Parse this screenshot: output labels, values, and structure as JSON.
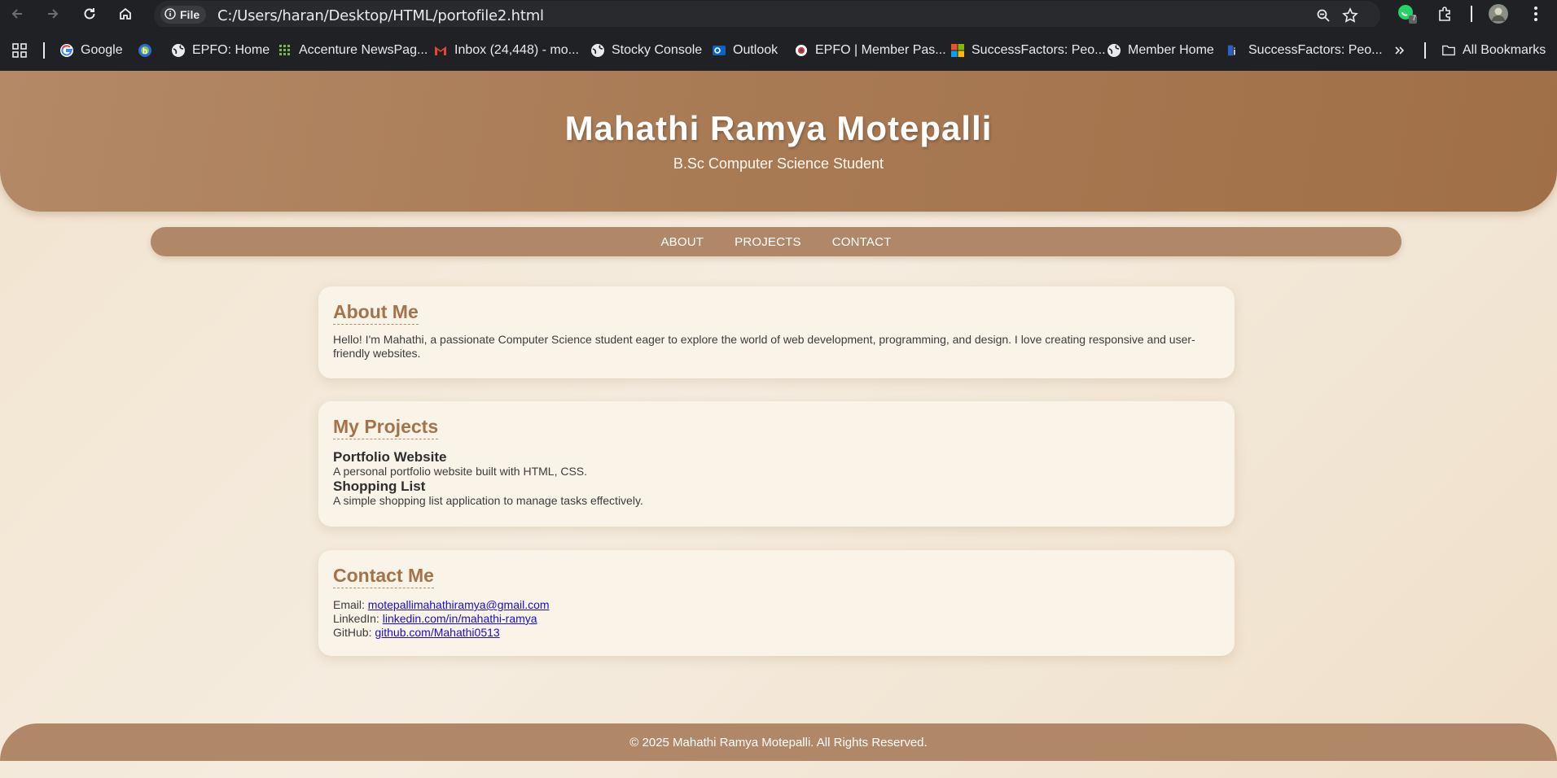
{
  "browser": {
    "url_chip_label": "File",
    "url": "C:/Users/haran/Desktop/HTML/portofile2.html",
    "extension_badge": "7",
    "bookmarks": [
      {
        "label": "Google",
        "icon": "google-icon"
      },
      {
        "label": "",
        "icon": "b-logo-icon"
      },
      {
        "label": "EPFO: Home",
        "icon": "globe-icon"
      },
      {
        "label": "Accenture NewsPag...",
        "icon": "grid-dots-icon"
      },
      {
        "label": "Inbox (24,448) - mo...",
        "icon": "gmail-icon"
      },
      {
        "label": "Stocky Console",
        "icon": "globe-icon"
      },
      {
        "label": "Outlook",
        "icon": "outlook-icon"
      },
      {
        "label": "EPFO | Member Pas...",
        "icon": "epfo-icon"
      },
      {
        "label": "SuccessFactors: Peo...",
        "icon": "microsoft-icon"
      },
      {
        "label": "Member Home",
        "icon": "globe-icon"
      },
      {
        "label": "SuccessFactors: Peo...",
        "icon": "sf-icon"
      }
    ],
    "all_bookmarks_label": "All Bookmarks"
  },
  "hero": {
    "name": "Mahathi Ramya Motepalli",
    "subtitle": "B.Sc Computer Science Student"
  },
  "nav": {
    "items": [
      "ABOUT",
      "PROJECTS",
      "CONTACT"
    ]
  },
  "about": {
    "heading": "About Me",
    "text": "Hello! I'm Mahathi, a passionate Computer Science student eager to explore the world of web development, programming, and design. I love creating responsive and user-friendly websites."
  },
  "projects": {
    "heading": "My Projects",
    "items": [
      {
        "title": "Portfolio Website",
        "desc": "A personal portfolio website built with HTML, CSS."
      },
      {
        "title": "Shopping List",
        "desc": "A simple shopping list application to manage tasks effectively."
      }
    ]
  },
  "contact": {
    "heading": "Contact Me",
    "email_label": "Email: ",
    "email": "motepallimahathiramya@gmail.com",
    "linkedin_label": "LinkedIn: ",
    "linkedin": "linkedin.com/in/mahathi-ramya",
    "github_label": "GitHub: ",
    "github": "github.com/Mahathi0513"
  },
  "footer": {
    "text": "© 2025 Mahathi Ramya Motepalli. All Rights Reserved."
  },
  "colors": {
    "hero": "#a97b55",
    "nav": "#b08868",
    "heading": "#a4734a",
    "card": "#faf3e8",
    "link": "#1a0dab"
  }
}
